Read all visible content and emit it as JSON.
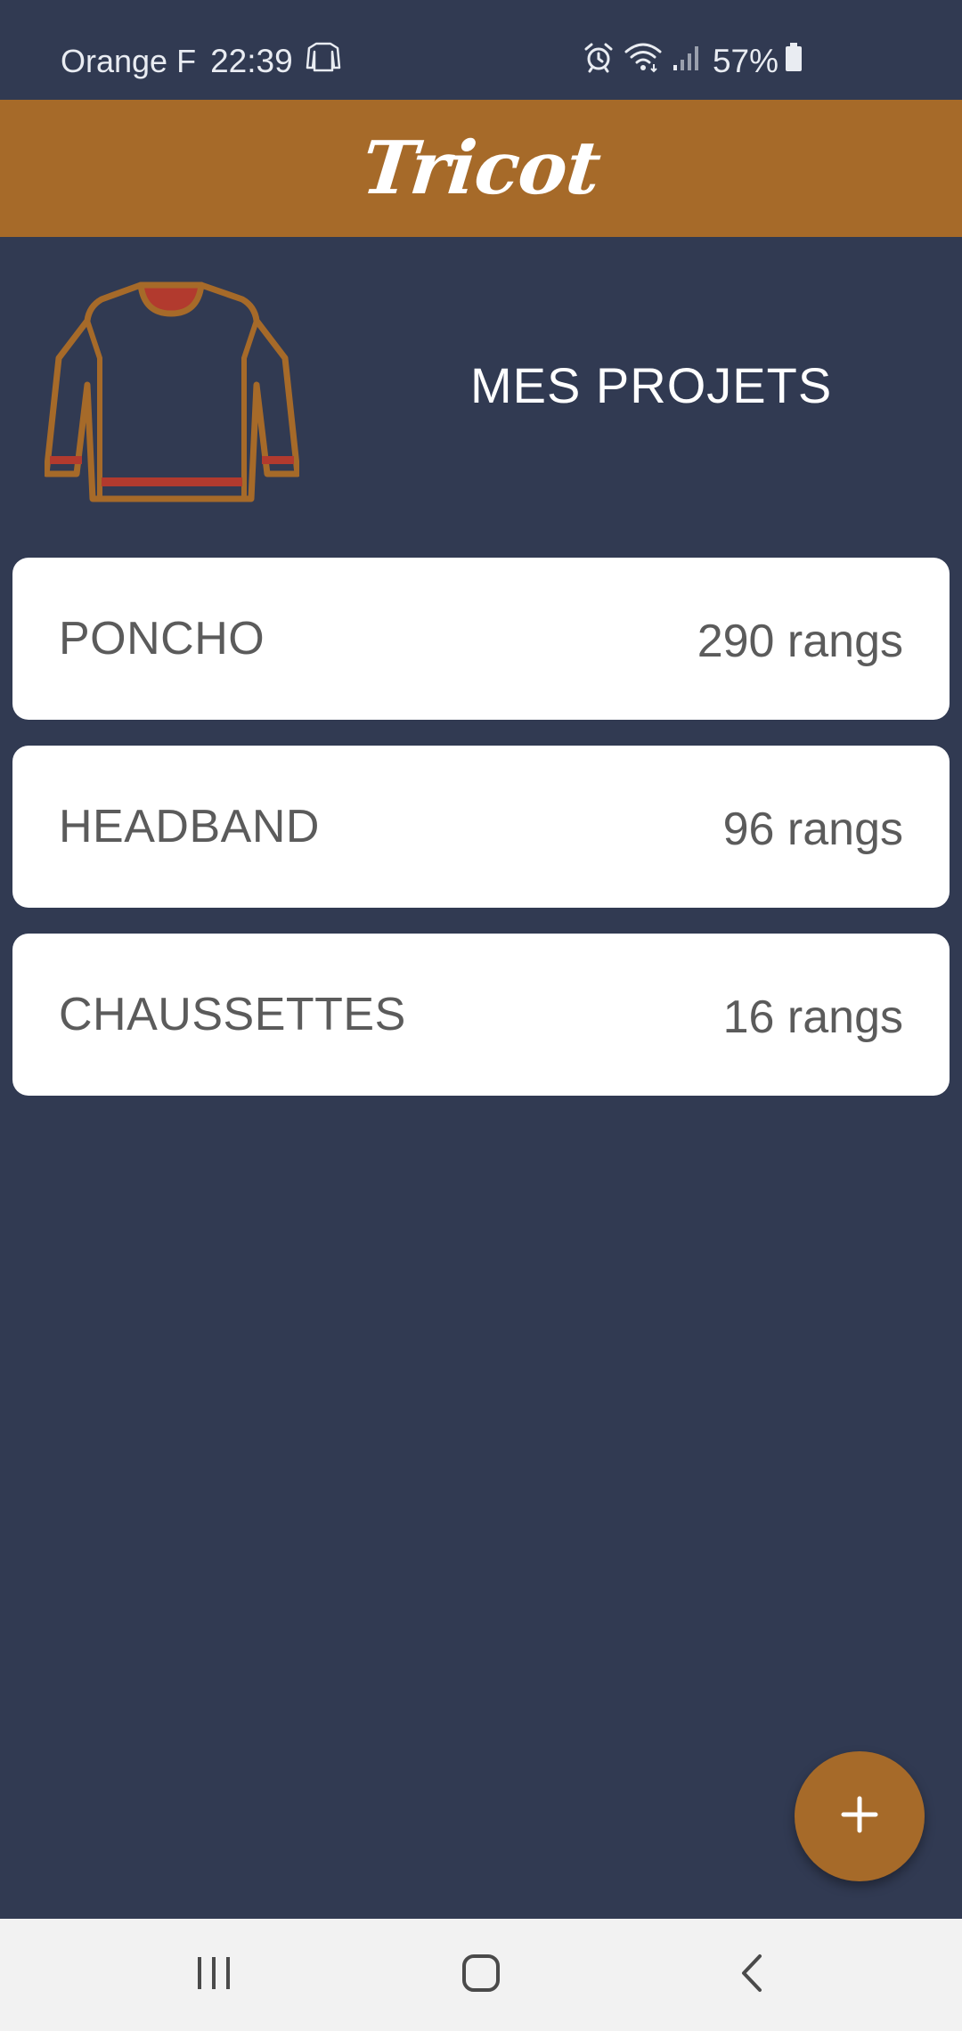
{
  "status_bar": {
    "carrier": "Orange F",
    "time": "22:39",
    "battery": "57%",
    "icons": [
      "sweater-notification-icon",
      "alarm-icon",
      "wifi-icon",
      "signal-icon",
      "battery-icon"
    ]
  },
  "app": {
    "title": "Tricot"
  },
  "hero": {
    "illustration": "sweater-illustration",
    "section_title": "MES PROJETS"
  },
  "projects": [
    {
      "name": "PONCHO",
      "rows": "290 rangs"
    },
    {
      "name": "HEADBAND",
      "rows": "96 rangs"
    },
    {
      "name": "CHAUSSETTES",
      "rows": "16 rangs"
    }
  ],
  "fab": {
    "label": "+",
    "icon": "plus-icon"
  },
  "nav": {
    "icons": [
      "recent-apps-icon",
      "home-icon",
      "back-icon"
    ]
  },
  "colors": {
    "background": "#313a52",
    "accent": "#a66a29",
    "card": "#ffffff",
    "card_text": "#5b5b5b",
    "sweater_trim": "#b23a2e"
  }
}
